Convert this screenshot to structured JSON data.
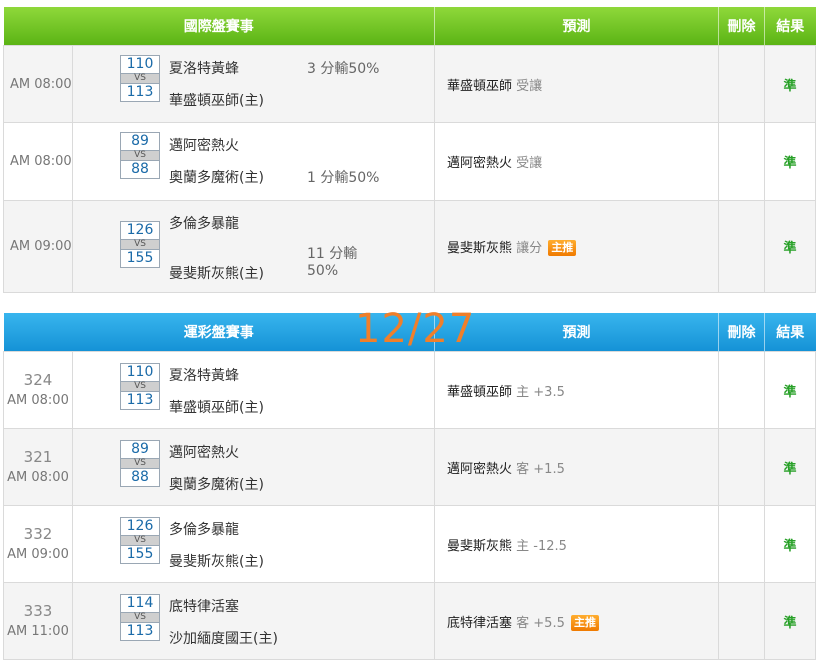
{
  "date_label": "12/27",
  "international": {
    "headers": {
      "event": "國際盤賽事",
      "prediction": "預測",
      "delete": "刪除",
      "result": "結果"
    },
    "rows": [
      {
        "time": "AM 08:00",
        "away_score": "110",
        "vs": "VS",
        "home_score": "113",
        "away_team": "夏洛特黃蜂",
        "home_team": "華盛頓巫師(主)",
        "handicap": "3 分輸50%",
        "pick_team": "華盛頓巫師",
        "pick_detail": "受讓",
        "badge": "",
        "result": "準"
      },
      {
        "time": "AM 08:00",
        "away_score": "89",
        "vs": "VS",
        "home_score": "88",
        "away_team": "邁阿密熱火",
        "home_team": "奧蘭多魔術(主)",
        "handicap": "1 分輸50%",
        "pick_team": "邁阿密熱火",
        "pick_detail": "受讓",
        "badge": "",
        "result": "準"
      },
      {
        "time": "AM 09:00",
        "away_score": "126",
        "vs": "VS",
        "home_score": "155",
        "away_team": "多倫多暴龍",
        "home_team": "曼斐斯灰熊(主)",
        "handicap_line1": "11 分輸",
        "handicap_line2": "50%",
        "pick_team": "曼斐斯灰熊",
        "pick_detail": "讓分",
        "badge": "主推",
        "result": "準"
      }
    ]
  },
  "sports_lottery": {
    "headers": {
      "event": "運彩盤賽事",
      "prediction": "預測",
      "delete": "刪除",
      "result": "結果"
    },
    "rows": [
      {
        "num": "324",
        "time": "AM 08:00",
        "away_score": "110",
        "vs": "VS",
        "home_score": "113",
        "away_team": "夏洛特黃蜂",
        "home_team": "華盛頓巫師(主)",
        "pick_team": "華盛頓巫師",
        "pick_detail": "主 +3.5",
        "badge": "",
        "result": "準"
      },
      {
        "num": "321",
        "time": "AM 08:00",
        "away_score": "89",
        "vs": "VS",
        "home_score": "88",
        "away_team": "邁阿密熱火",
        "home_team": "奧蘭多魔術(主)",
        "pick_team": "邁阿密熱火",
        "pick_detail": "客 +1.5",
        "badge": "",
        "result": "準"
      },
      {
        "num": "332",
        "time": "AM 09:00",
        "away_score": "126",
        "vs": "VS",
        "home_score": "155",
        "away_team": "多倫多暴龍",
        "home_team": "曼斐斯灰熊(主)",
        "pick_team": "曼斐斯灰熊",
        "pick_detail": "主 -12.5",
        "badge": "",
        "result": "準"
      },
      {
        "num": "333",
        "time": "AM 11:00",
        "away_score": "114",
        "vs": "VS",
        "home_score": "113",
        "away_team": "底特律活塞",
        "home_team": "沙加緬度國王(主)",
        "pick_team": "底特律活塞",
        "pick_detail": "客 +5.5",
        "badge": "主推",
        "result": "準"
      }
    ]
  }
}
